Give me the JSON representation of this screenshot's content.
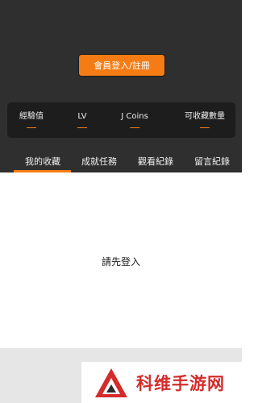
{
  "header": {
    "login_button": "會員登入/註冊"
  },
  "stats": [
    {
      "label": "經驗值"
    },
    {
      "label": "LV"
    },
    {
      "label": "J Coins"
    },
    {
      "label": "可收藏數量"
    }
  ],
  "tabs": [
    {
      "label": "我的收藏",
      "active": true
    },
    {
      "label": "成就任務"
    },
    {
      "label": "觀看紀錄"
    },
    {
      "label": "留言紀錄"
    }
  ],
  "main": {
    "message": "請先登入"
  },
  "watermark": {
    "text": "科维手游网"
  },
  "colors": {
    "accent": "#f57c14",
    "header_bg": "#2f2f2f",
    "stats_bg": "#1d1d1d",
    "watermark_red": "#d42b2b"
  }
}
